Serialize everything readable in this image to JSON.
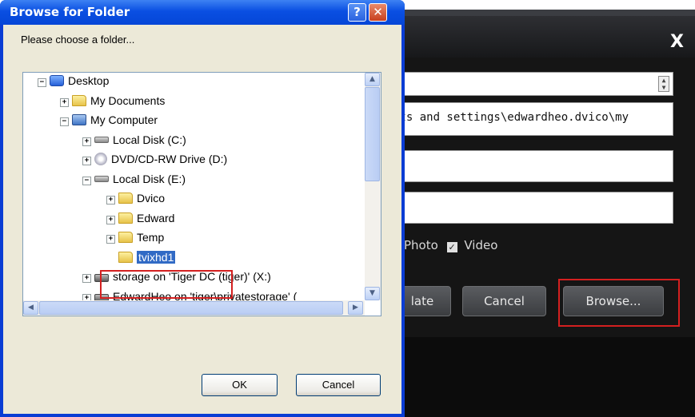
{
  "app": {
    "close_glyph": "X",
    "path_value": "nts and settings\\edwardheo.dvico\\my",
    "photo_label": "Photo",
    "video_label": "Video",
    "update_btn": "late",
    "cancel_btn": "Cancel",
    "browse_btn": "Browse..."
  },
  "browse_dialog": {
    "title": "Browse for Folder",
    "help_glyph": "?",
    "close_glyph": "✕",
    "prompt": "Please choose a folder...",
    "ok_label": "OK",
    "cancel_label": "Cancel",
    "tree": [
      {
        "label": "Desktop",
        "icon": "desktop-icon",
        "expander": "−"
      },
      {
        "label": "My Documents",
        "icon": "folder-icon",
        "expander": "+"
      },
      {
        "label": "My Computer",
        "icon": "computer-icon",
        "expander": "−"
      },
      {
        "label": "Local Disk (C:)",
        "icon": "drive-icon",
        "expander": "+"
      },
      {
        "label": "DVD/CD-RW Drive (D:)",
        "icon": "dvd-icon",
        "expander": "+"
      },
      {
        "label": "Local Disk (E:)",
        "icon": "drive-icon",
        "expander": "−"
      },
      {
        "label": "Dvico",
        "icon": "folder-icon",
        "expander": "+"
      },
      {
        "label": "Edward",
        "icon": "folder-icon",
        "expander": "+"
      },
      {
        "label": "Temp",
        "icon": "folder-icon",
        "expander": "+"
      },
      {
        "label": "tvixhd1",
        "icon": "folder-icon",
        "expander": ""
      },
      {
        "label": "storage on 'Tiger DC (tiger)' (X:)",
        "icon": "network-drive-icon",
        "expander": "+"
      },
      {
        "label": "EdwardHeo on 'tiger\\privatestorage' (",
        "icon": "network-drive-icon",
        "expander": "+"
      }
    ],
    "selected_item": "tvixhd1"
  },
  "colors": {
    "xp_title_blue": "#0a4fe2",
    "selection_blue": "#316ac5",
    "highlight_red": "#d42020",
    "app_background": "#0c0c0c"
  }
}
